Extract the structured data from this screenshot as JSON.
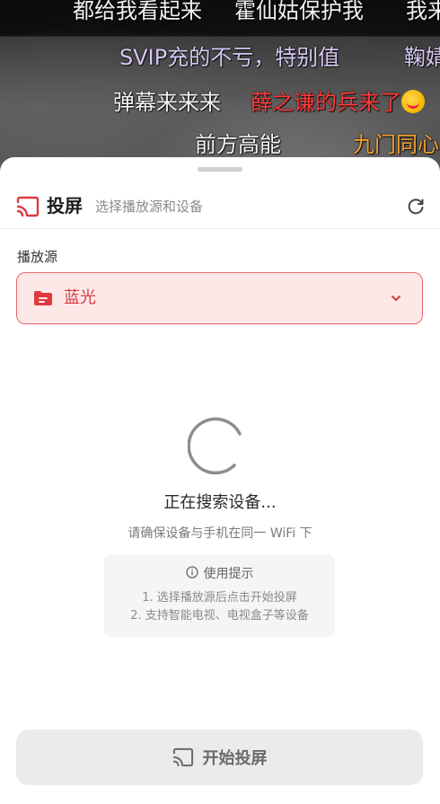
{
  "danmaku": [
    {
      "text": "都给我看起来",
      "color": "white"
    },
    {
      "text": "霍仙姑保护我",
      "color": "white"
    },
    {
      "text": "我来",
      "color": "white"
    },
    {
      "text": "SVIP充的不亏，特别值",
      "color": "lilac"
    },
    {
      "text": "鞠婧",
      "color": "lilac"
    },
    {
      "text": "弹幕来来来",
      "color": "white"
    },
    {
      "text": "薛之谦的兵来了",
      "color": "red"
    },
    {
      "text": "前方高能",
      "color": "white"
    },
    {
      "text": "九门同心",
      "color": "orange"
    }
  ],
  "colors": {
    "accent": "#e0393f",
    "select_bg": "#fde8e8",
    "select_border": "#e8676d",
    "button_bg": "#ebebeb"
  },
  "header": {
    "icon": "cast-icon",
    "title": "投屏",
    "subtitle": "选择播放源和设备",
    "refresh_icon": "refresh-icon"
  },
  "source": {
    "label": "播放源",
    "icon": "folder-icon",
    "selected": "蓝光",
    "dropdown_icon": "chevron-down-icon"
  },
  "status": {
    "searching": "正在搜索设备...",
    "hint": "请确保设备与手机在同一 WiFi 下"
  },
  "tips": {
    "icon": "info-icon",
    "title": "使用提示",
    "items": [
      "1. 选择播放源后点击开始投屏",
      "2. 支持智能电视、电视盒子等设备"
    ]
  },
  "start_button": {
    "icon": "cast-icon",
    "label": "开始投屏"
  }
}
